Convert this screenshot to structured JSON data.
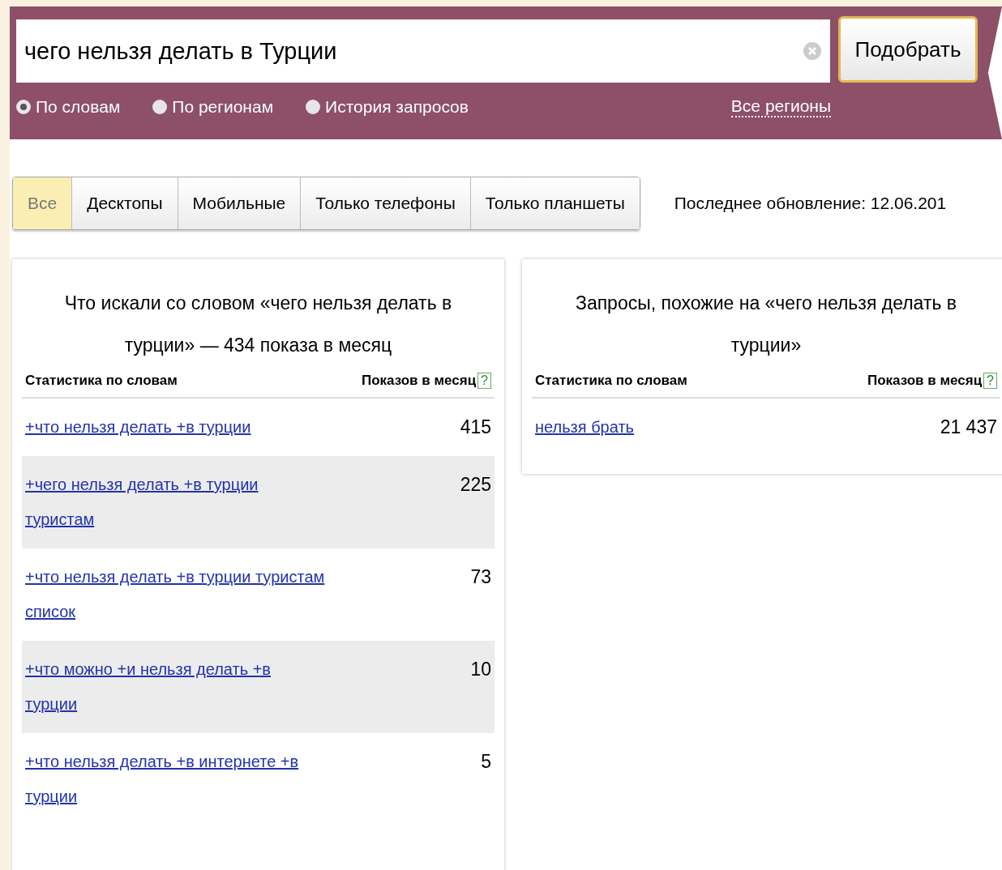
{
  "search": {
    "value": "чего нельзя делать в Турции",
    "button": "Подобрать"
  },
  "modes": [
    {
      "label": "По словам",
      "selected": true
    },
    {
      "label": "По регионам",
      "selected": false
    },
    {
      "label": "История запросов",
      "selected": false
    }
  ],
  "region_link": "Все регионы",
  "tabs": [
    {
      "label": "Все",
      "selected": true
    },
    {
      "label": "Десктопы",
      "selected": false
    },
    {
      "label": "Мобильные",
      "selected": false
    },
    {
      "label": "Только телефоны",
      "selected": false
    },
    {
      "label": "Только планшеты",
      "selected": false
    }
  ],
  "last_update": "Последнее обновление: 12.06.201",
  "panels": [
    {
      "title": "Что искали со словом «чего нельзя делать в турции» — 434 показа в месяц",
      "column_1": "Статистика по словам",
      "column_2": "Показов в месяц",
      "help": "?",
      "rows": [
        {
          "phrase": "+что нельзя делать +в турции",
          "count": "415"
        },
        {
          "phrase": "+чего нельзя делать +в турции туристам",
          "count": "225"
        },
        {
          "phrase": "+что нельзя делать +в турции туристам список",
          "count": "73"
        },
        {
          "phrase": "+что можно +и нельзя делать +в турции",
          "count": "10"
        },
        {
          "phrase": "+что нельзя делать +в интернете +в турции",
          "count": "5"
        }
      ]
    },
    {
      "title": "Запросы, похожие на «чего нельзя делать в турции»",
      "column_1": "Статистика по словам",
      "column_2": "Показов в месяц",
      "help": "?",
      "rows": [
        {
          "phrase": "нельзя брать",
          "count": "21 437"
        }
      ]
    }
  ]
}
